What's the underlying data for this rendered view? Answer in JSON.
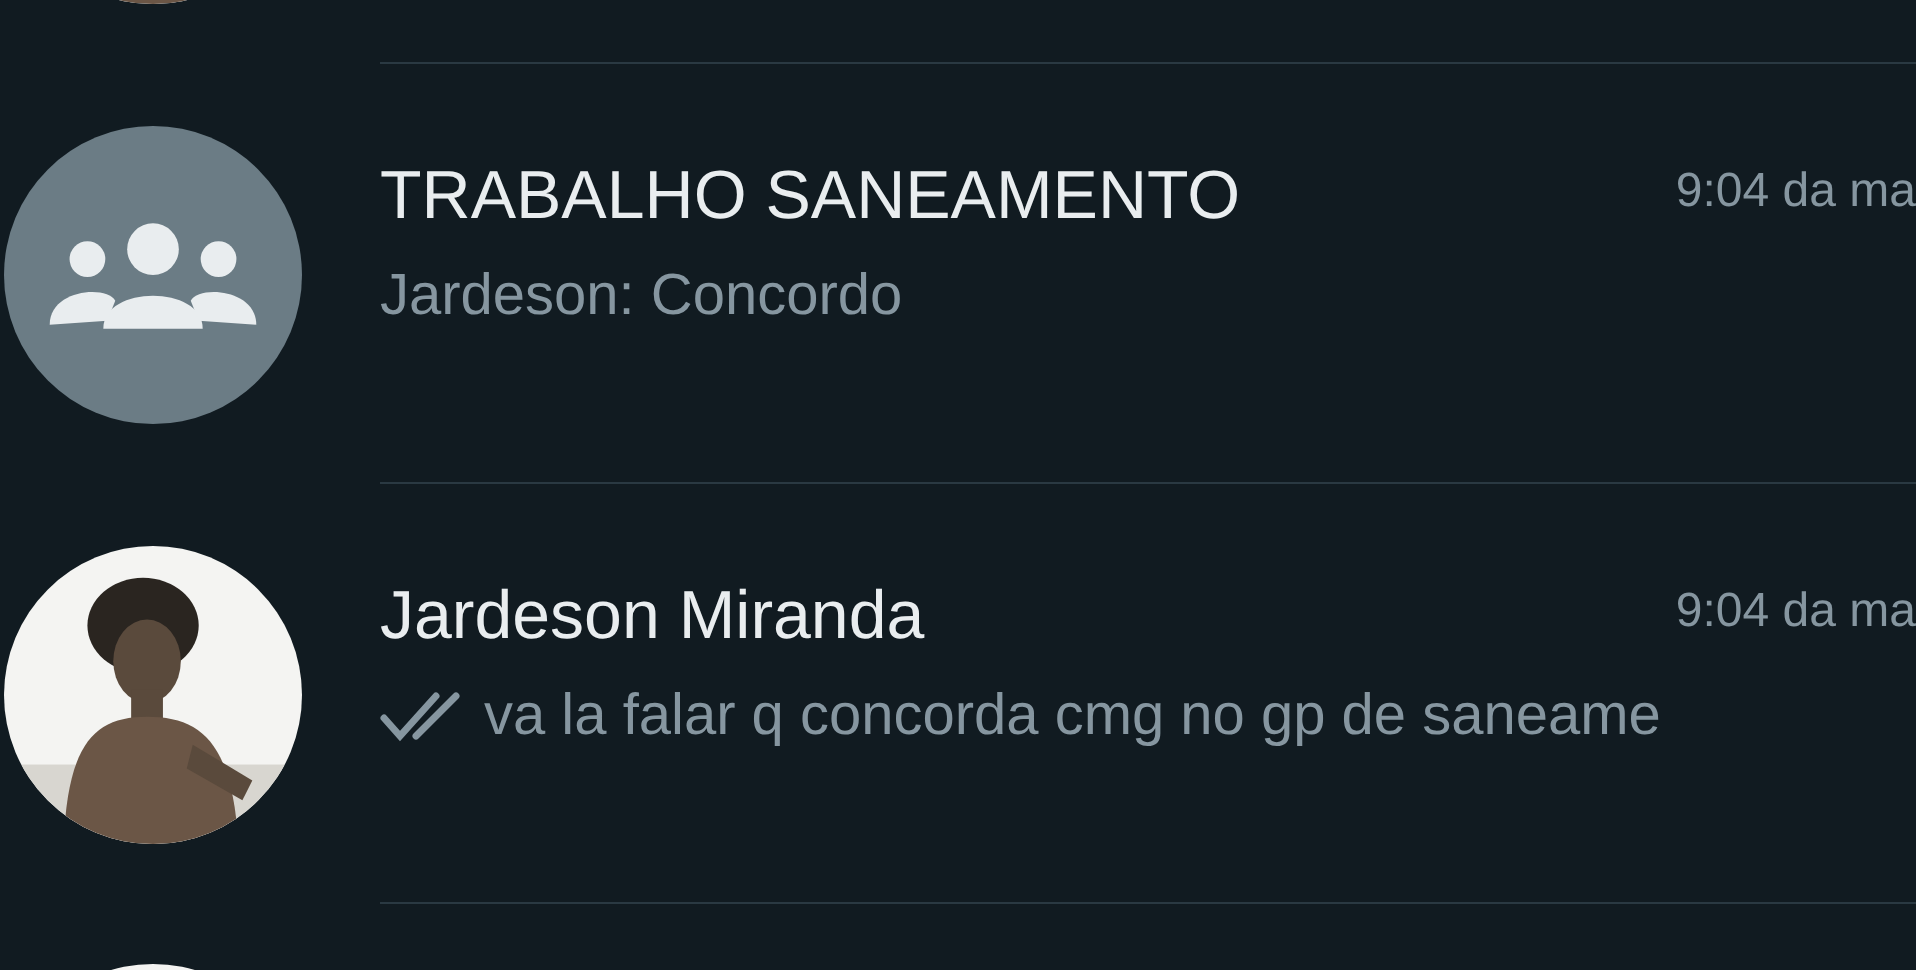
{
  "chats": [
    {
      "avatar": {
        "kind": "picture"
      }
    },
    {
      "avatar": {
        "kind": "group"
      },
      "name": "TRABALHO SANEAMENTO",
      "time": "9:04 da ma",
      "preview": "Jardeson: Concordo"
    },
    {
      "avatar": {
        "kind": "picture"
      },
      "name": "Jardeson Miranda",
      "time": "9:04 da ma",
      "read": false,
      "preview": "va la falar q concorda cmg no gp de saneame"
    },
    {
      "avatar": {
        "kind": "picture"
      }
    }
  ]
}
